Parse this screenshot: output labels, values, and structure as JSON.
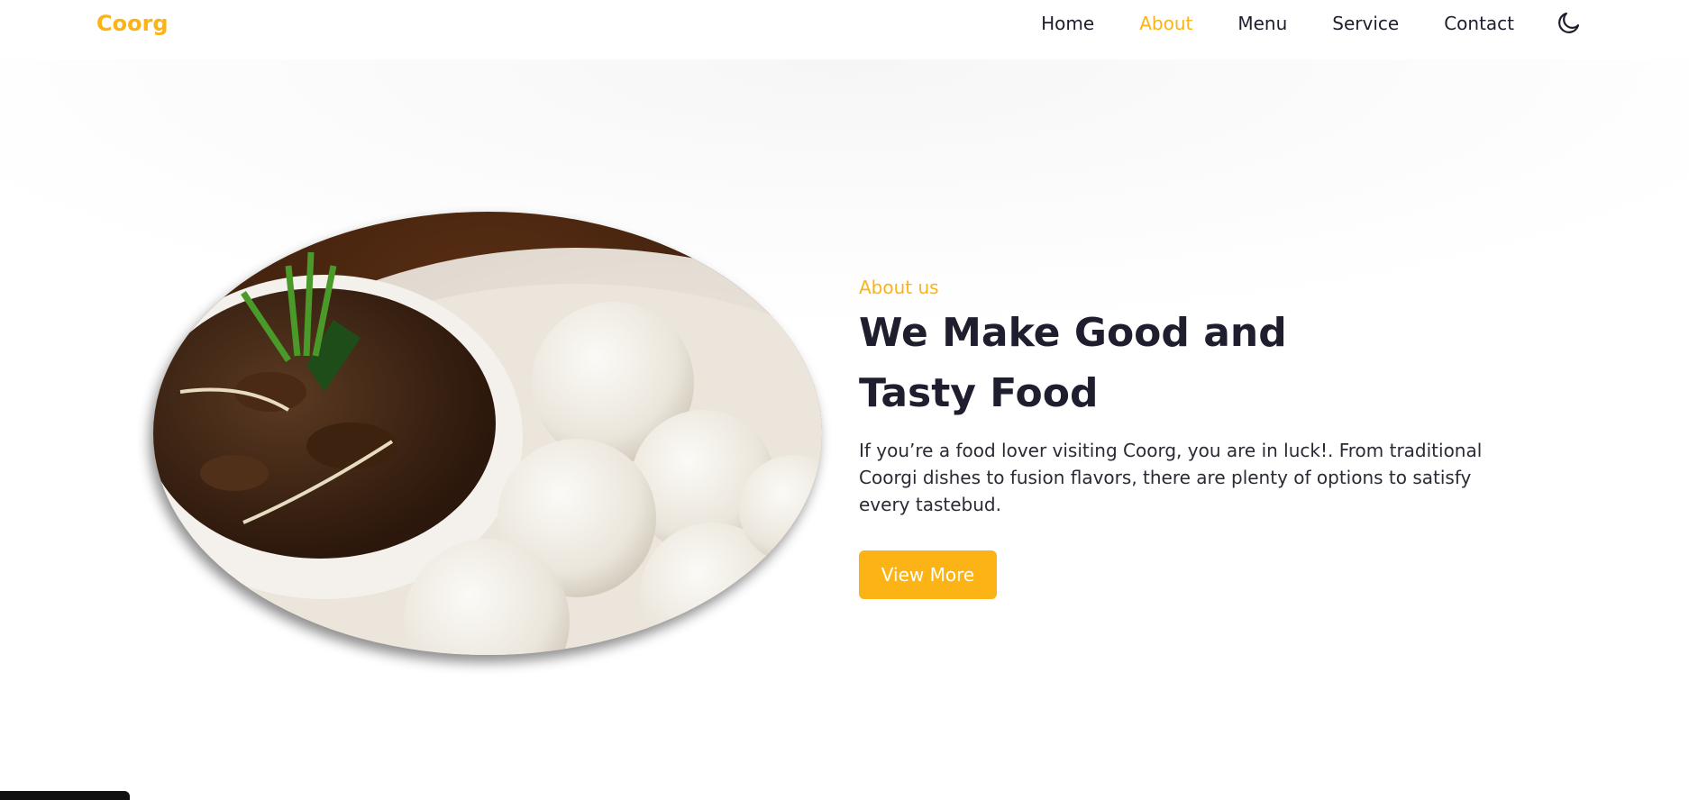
{
  "header": {
    "logo": "Coorg",
    "nav": [
      {
        "label": "Home",
        "active": false
      },
      {
        "label": "About",
        "active": true
      },
      {
        "label": "Menu",
        "active": false
      },
      {
        "label": "Service",
        "active": false
      },
      {
        "label": "Contact",
        "active": false
      }
    ],
    "theme_icon": "moon-icon"
  },
  "about": {
    "label": "About us",
    "headline_line1": "We Make Good and",
    "headline_line2": "Tasty Food",
    "description": "If you’re a food lover visiting Coorg, you are in luck!. From traditional Coorgi dishes to fusion flavors, there are plenty of options to satisfy every tastebud.",
    "button_label": "View More",
    "image": "food-plate-image"
  },
  "colors": {
    "accent": "#fbb315",
    "text": "#1f1e2e",
    "background": "#ffffff"
  }
}
